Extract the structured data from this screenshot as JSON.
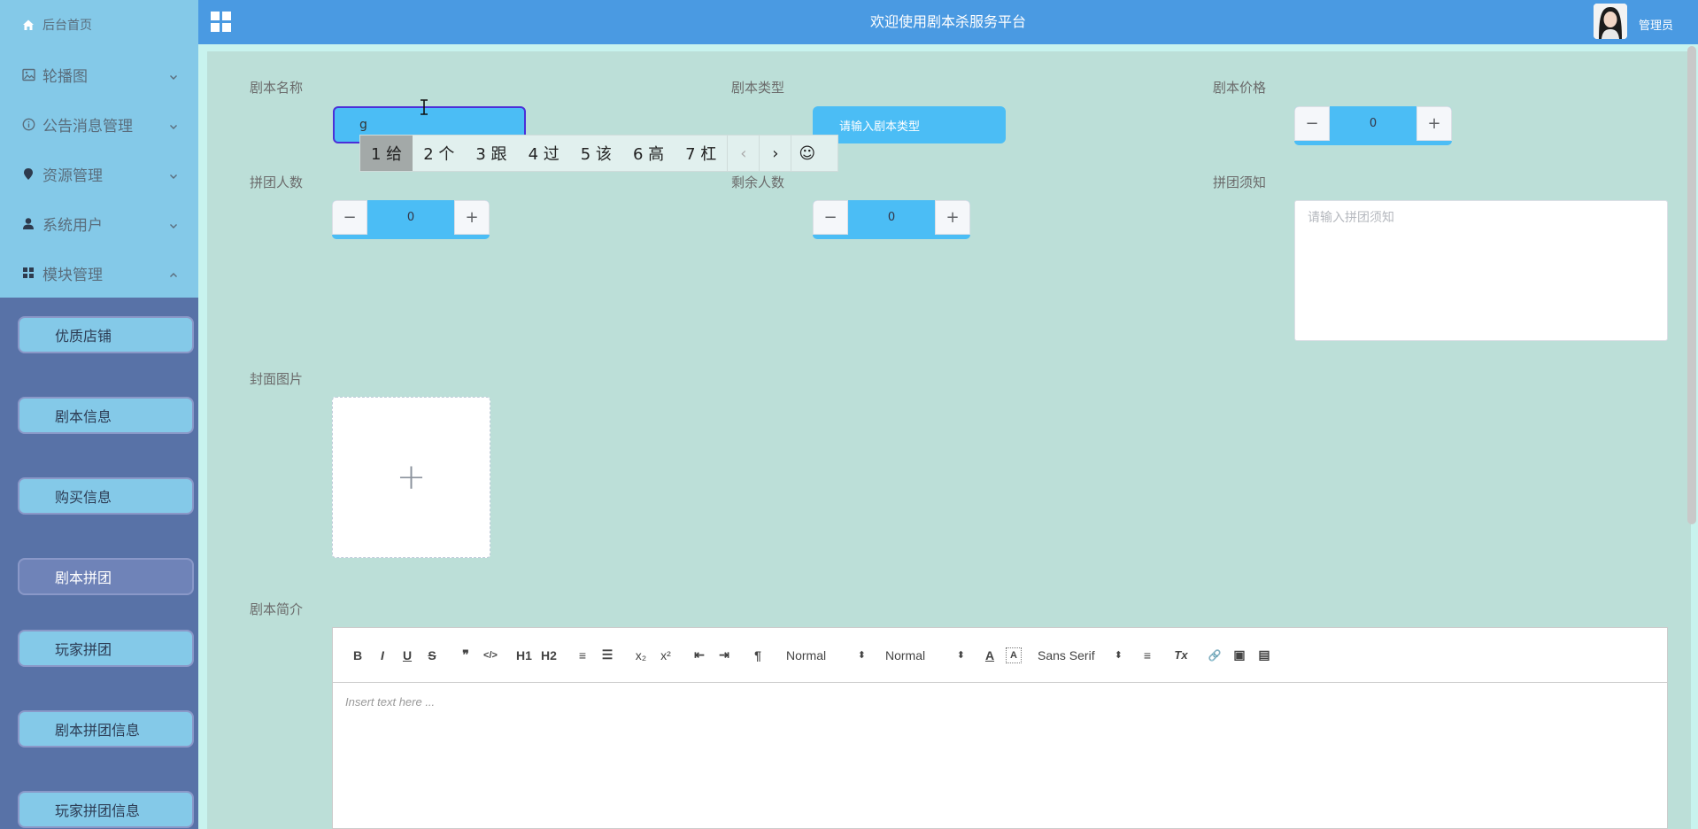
{
  "sidebar": {
    "home": "后台首页",
    "menus": [
      {
        "label": "轮播图",
        "icon": "image-icon"
      },
      {
        "label": "公告消息管理",
        "icon": "info-icon"
      },
      {
        "label": "资源管理",
        "icon": "location-icon"
      },
      {
        "label": "系统用户",
        "icon": "user-icon"
      },
      {
        "label": "模块管理",
        "icon": "grid-icon"
      }
    ],
    "submenu": [
      "优质店铺",
      "剧本信息",
      "购买信息",
      "剧本拼团",
      "玩家拼团",
      "剧本拼团信息",
      "玩家拼团信息"
    ],
    "active_submenu": "剧本拼团"
  },
  "header": {
    "title": "欢迎使用剧本杀服务平台",
    "user": "管理员"
  },
  "form": {
    "name_label": "剧本名称",
    "name_value": "g",
    "type_label": "剧本类型",
    "type_placeholder": "请输入剧本类型",
    "price_label": "剧本价格",
    "price_value": "0",
    "group_label": "拼团人数",
    "group_value": "0",
    "remain_label": "剩余人数",
    "remain_value": "0",
    "notice_label": "拼团须知",
    "notice_placeholder": "请输入拼团须知",
    "cover_label": "封面图片",
    "intro_label": "剧本简介"
  },
  "stepper": {
    "minus": "−",
    "plus": "+"
  },
  "upload": {
    "plus": "+"
  },
  "ime": {
    "candidates": [
      "1 给",
      "2 个",
      "3 跟",
      "4 过",
      "5 该",
      "6 高",
      "7 杠"
    ],
    "prev": "‹",
    "next": "›",
    "emoji": "☺"
  },
  "editor": {
    "buttons": {
      "bold": "B",
      "italic": "I",
      "underline": "U",
      "strike": "S",
      "quote": "❞",
      "code": "</>",
      "h1": "H1",
      "h2": "H2",
      "ordered": "≡",
      "bullet": "☰",
      "sub": "x₂",
      "sup": "x²",
      "outdent": "⇤",
      "indent": "⇥",
      "direction": "¶",
      "color": "A",
      "background": "A",
      "align": "≡",
      "clean": "Tx",
      "link": "🔗",
      "image": "▣",
      "video": "▤"
    },
    "header_select": "Normal",
    "size_select": "Normal",
    "font_select": "Sans Serif",
    "select_arrow": "⬍",
    "placeholder": "Insert text here ..."
  }
}
